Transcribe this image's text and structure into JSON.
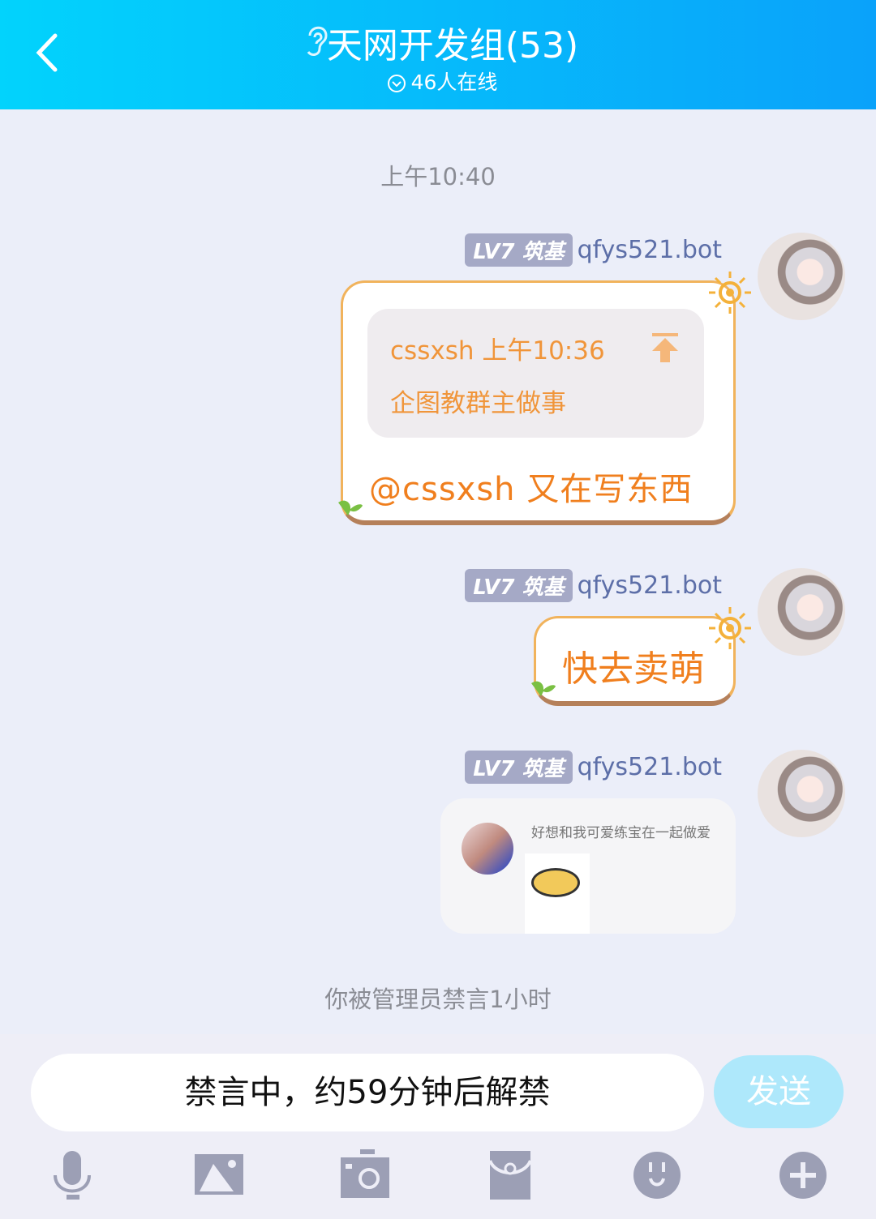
{
  "header": {
    "title": "天网开发组(53)",
    "online": "46人在线"
  },
  "timestamp": "上午10:40",
  "messages": [
    {
      "level": "LV7",
      "rank": "筑基",
      "sender": "qfys521.bot",
      "quote": {
        "author_time": "cssxsh 上午10:36",
        "text": "企图教群主做事"
      },
      "text": "@cssxsh 又在写东西"
    },
    {
      "level": "LV7",
      "rank": "筑基",
      "sender": "qfys521.bot",
      "text": "快去卖萌"
    },
    {
      "level": "LV7",
      "rank": "筑基",
      "sender": "qfys521.bot",
      "card_text": "好想和我可爱练宝在一起做爱"
    }
  ],
  "system_notice": "你被管理员禁言1小时",
  "input": {
    "value": "禁言中，约59分钟后解禁",
    "send_label": "发送"
  },
  "toolbar": [
    "mic-icon",
    "image-icon",
    "camera-icon",
    "red-packet-icon",
    "emoji-icon",
    "plus-icon"
  ],
  "colors": {
    "header_start": "#02d3fc",
    "header_end": "#0aa2fa",
    "bubble_text": "#f07f1e",
    "badge": "#a5a9c6",
    "icon": "#9c9fb5"
  }
}
